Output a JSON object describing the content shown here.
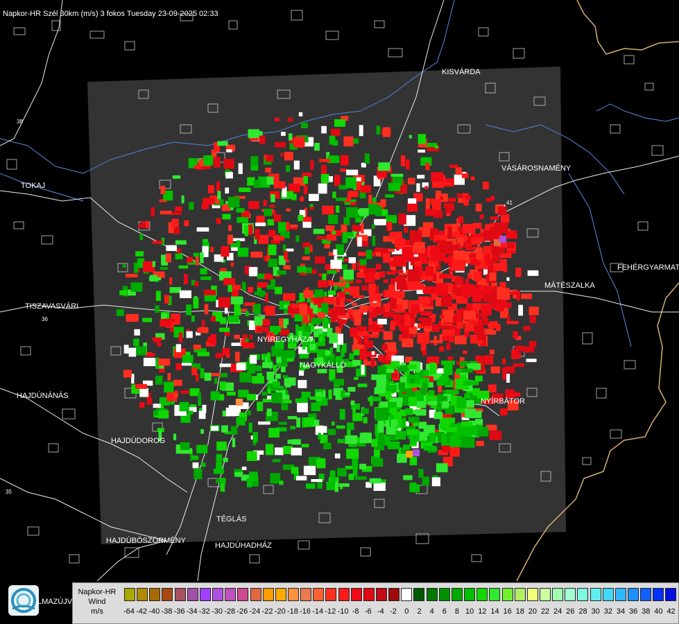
{
  "header": {
    "title": "Napkor-HR Szél 30km (m/s) 3 fokos Tuesday 23-09-2025 02:33"
  },
  "map": {
    "cities": [
      {
        "name": "KISVÁRDA"
      },
      {
        "name": "VÁSÁROSNAMÉNY"
      },
      {
        "name": "TOKAJ"
      },
      {
        "name": "FEHÉRGYARMAT"
      },
      {
        "name": "MÁTÉSZALKA"
      },
      {
        "name": "TISZAVASVÁRI"
      },
      {
        "name": "NYÍREGYHÁZA"
      },
      {
        "name": "NAGYKÁLLÓ"
      },
      {
        "name": "NYÍRBÁTOR"
      },
      {
        "name": "HAJDÚNÁNÁS"
      },
      {
        "name": "HAJDÚDOROG"
      },
      {
        "name": "TÉGLÁS"
      },
      {
        "name": "HAJDÚBÖSZÖRMÉNY"
      },
      {
        "name": "HAJDÚHADHÁZ"
      }
    ],
    "road_numbers": [
      "38",
      "41",
      "36",
      "35"
    ]
  },
  "logo": {
    "name": "logo-icon",
    "text": "LMAZÚJVÁR"
  },
  "legend": {
    "title_lines": [
      "Napkor-HR",
      "Wind",
      "m/s"
    ],
    "bins": [
      {
        "label": "-64",
        "color": "#a8a800"
      },
      {
        "label": "-42",
        "color": "#b08a00"
      },
      {
        "label": "-40",
        "color": "#a86a00"
      },
      {
        "label": "-38",
        "color": "#a84a10"
      },
      {
        "label": "-36",
        "color": "#a85060"
      },
      {
        "label": "-34",
        "color": "#a050a8"
      },
      {
        "label": "-32",
        "color": "#a040ff"
      },
      {
        "label": "-30",
        "color": "#b050e0"
      },
      {
        "label": "-28",
        "color": "#c050c0"
      },
      {
        "label": "-26",
        "color": "#d04890"
      },
      {
        "label": "-24",
        "color": "#e06840"
      },
      {
        "label": "-22",
        "color": "#ff9c00"
      },
      {
        "label": "-20",
        "color": "#ffaa00"
      },
      {
        "label": "-18",
        "color": "#ff9040"
      },
      {
        "label": "-16",
        "color": "#e87a50"
      },
      {
        "label": "-14",
        "color": "#ff6030"
      },
      {
        "label": "-12",
        "color": "#ff3020"
      },
      {
        "label": "-10",
        "color": "#ff1a1a"
      },
      {
        "label": "-8",
        "color": "#ee0a14"
      },
      {
        "label": "-6",
        "color": "#dd0a14"
      },
      {
        "label": "-4",
        "color": "#c40a14"
      },
      {
        "label": "-2",
        "color": "#a00a0a"
      },
      {
        "label": "0",
        "color": "#ffffff"
      },
      {
        "label": "2",
        "color": "#005a00"
      },
      {
        "label": "4",
        "color": "#007800"
      },
      {
        "label": "6",
        "color": "#009000"
      },
      {
        "label": "8",
        "color": "#00a800"
      },
      {
        "label": "10",
        "color": "#00c000"
      },
      {
        "label": "12",
        "color": "#10d800"
      },
      {
        "label": "14",
        "color": "#30e830"
      },
      {
        "label": "16",
        "color": "#70f030"
      },
      {
        "label": "18",
        "color": "#b0f060"
      },
      {
        "label": "20",
        "color": "#f0ff80"
      },
      {
        "label": "22",
        "color": "#c8ffa0"
      },
      {
        "label": "24",
        "color": "#a0ffb0"
      },
      {
        "label": "26",
        "color": "#a0ffd0"
      },
      {
        "label": "28",
        "color": "#80f8e0"
      },
      {
        "label": "30",
        "color": "#60f0f0"
      },
      {
        "label": "32",
        "color": "#40d8ff"
      },
      {
        "label": "34",
        "color": "#30b8ff"
      },
      {
        "label": "36",
        "color": "#1e90ff"
      },
      {
        "label": "38",
        "color": "#1060ff"
      },
      {
        "label": "40",
        "color": "#0030ff"
      },
      {
        "label": "42",
        "color": "#0010e0"
      }
    ]
  }
}
